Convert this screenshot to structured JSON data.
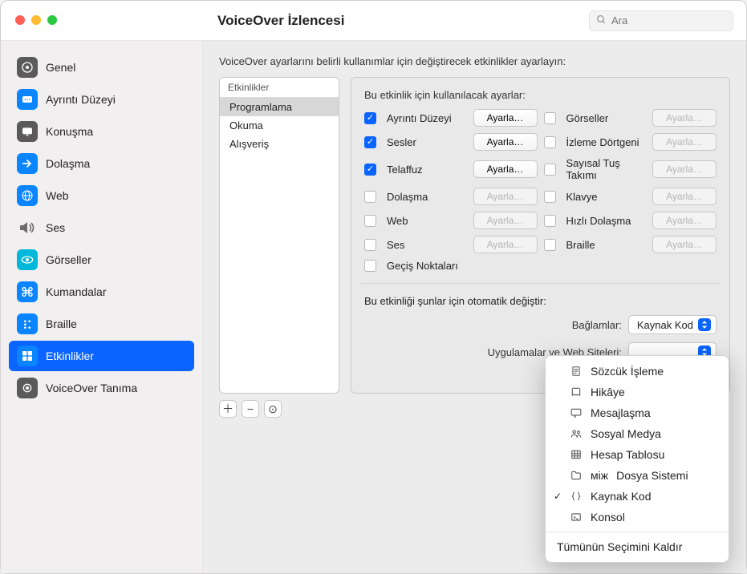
{
  "window": {
    "title": "VoiceOver İzlencesi"
  },
  "search": {
    "placeholder": "Ara"
  },
  "sidebar": {
    "items": [
      {
        "label": "Genel"
      },
      {
        "label": "Ayrıntı Düzeyi"
      },
      {
        "label": "Konuşma"
      },
      {
        "label": "Dolaşma"
      },
      {
        "label": "Web"
      },
      {
        "label": "Ses"
      },
      {
        "label": "Görseller"
      },
      {
        "label": "Kumandalar"
      },
      {
        "label": "Braille"
      },
      {
        "label": "Etkinlikler"
      },
      {
        "label": "VoiceOver Tanıma"
      }
    ],
    "selected_index": 9
  },
  "content": {
    "description": "VoiceOver ayarlarını belirli kullanımlar için değiştirecek etkinlikler ayarlayın:"
  },
  "activities": {
    "header": "Etkinlikler",
    "items": [
      {
        "label": "Programlama"
      },
      {
        "label": "Okuma"
      },
      {
        "label": "Alışveriş"
      }
    ],
    "selected_index": 0
  },
  "settings": {
    "title": "Bu etkinlik için kullanılacak ayarlar:",
    "configure_label": "Ayarla…",
    "options": [
      {
        "label": "Ayrıntı Düzeyi",
        "checked": true,
        "enabled": true
      },
      {
        "label": "Görseller",
        "checked": false,
        "enabled": false
      },
      {
        "label": "Sesler",
        "checked": true,
        "enabled": true
      },
      {
        "label": "İzleme Dörtgeni",
        "checked": false,
        "enabled": false
      },
      {
        "label": "Telaffuz",
        "checked": true,
        "enabled": true
      },
      {
        "label": "Sayısal Tuş Takımı",
        "checked": false,
        "enabled": false
      },
      {
        "label": "Dolaşma",
        "checked": false,
        "enabled": false
      },
      {
        "label": "Klavye",
        "checked": false,
        "enabled": false
      },
      {
        "label": "Web",
        "checked": false,
        "enabled": false
      },
      {
        "label": "Hızlı Dolaşma",
        "checked": false,
        "enabled": false
      },
      {
        "label": "Ses",
        "checked": false,
        "enabled": false
      },
      {
        "label": "Braille",
        "checked": false,
        "enabled": false
      },
      {
        "label": "Geçiş Noktaları",
        "checked": false,
        "enabled": null
      }
    ],
    "auto_title": "Bu etkinliği şunlar için otomatik değiştir:",
    "contexts_label": "Bağlamlar:",
    "contexts_value": "Kaynak Kod",
    "apps_label": "Uygulamalar ve Web Siteleri:"
  },
  "menu": {
    "items": [
      {
        "label": "Sözcük İşleme",
        "icon": "document-icon",
        "checked": false
      },
      {
        "label": "Hikâye",
        "icon": "book-icon",
        "checked": false
      },
      {
        "label": "Mesajlaşma",
        "icon": "chat-icon",
        "checked": false
      },
      {
        "label": "Sosyal Medya",
        "icon": "people-icon",
        "checked": false
      },
      {
        "label": "Hesap Tablosu",
        "icon": "table-icon",
        "checked": false
      },
      {
        "label": "Dosya Sistemi",
        "icon": "folder-icon",
        "checked": false
      },
      {
        "label": "Kaynak Kod",
        "icon": "braces-icon",
        "checked": true
      },
      {
        "label": "Konsol",
        "icon": "terminal-icon",
        "checked": false
      }
    ],
    "deselect_all": "Tümünün Seçimini Kaldır"
  }
}
